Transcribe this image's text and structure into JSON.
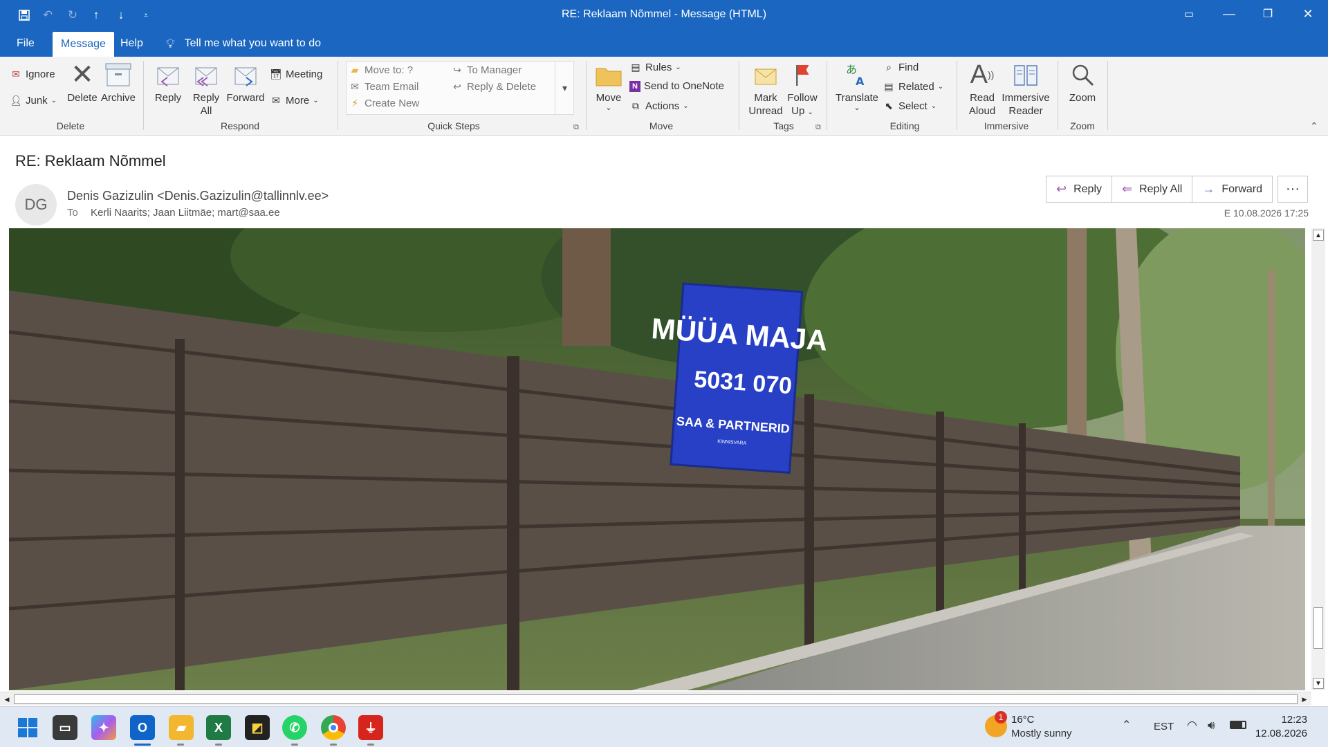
{
  "window": {
    "title": "RE: Reklaam Nõmmel  -  Message (HTML)"
  },
  "menu": {
    "tabs": [
      "File",
      "Message",
      "Help"
    ],
    "tell_me": "Tell me what you want to do"
  },
  "ribbon": {
    "delete_group": {
      "label": "Delete",
      "ignore": "Ignore",
      "junk": "Junk",
      "delete": "Delete",
      "archive": "Archive"
    },
    "respond_group": {
      "label": "Respond",
      "reply": "Reply",
      "reply_all_1": "Reply",
      "reply_all_2": "All",
      "forward": "Forward",
      "meeting": "Meeting",
      "more": "More"
    },
    "quick_steps": {
      "label": "Quick Steps",
      "items": [
        "Move to: ?",
        "Team Email",
        "Create New",
        "To Manager",
        "Reply & Delete"
      ]
    },
    "move_group": {
      "label": "Move",
      "move": "Move",
      "rules": "Rules",
      "onenote": "Send to OneNote",
      "actions": "Actions"
    },
    "tags_group": {
      "label": "Tags",
      "mark_unread_1": "Mark",
      "mark_unread_2": "Unread",
      "follow_up_1": "Follow",
      "follow_up_2": "Up"
    },
    "editing_group": {
      "label": "Editing",
      "translate": "Translate",
      "find": "Find",
      "related": "Related",
      "select": "Select"
    },
    "immersive_group": {
      "label": "Immersive",
      "read_aloud_1": "Read",
      "read_aloud_2": "Aloud",
      "immersive_reader_1": "Immersive",
      "immersive_reader_2": "Reader"
    },
    "zoom_group": {
      "label": "Zoom",
      "zoom": "Zoom"
    }
  },
  "message": {
    "subject": "RE: Reklaam Nõmmel",
    "avatar_initials": "DG",
    "sender": "Denis Gazizulin <Denis.Gazizulin@tallinnlv.ee>",
    "to_label": "To",
    "recipients": "Kerli Naarits; Jaan Liitmäe; mart@saa.ee",
    "datetime": "E 10.08.2026 17:25",
    "actions": {
      "reply": "Reply",
      "reply_all": "Reply All",
      "forward": "Forward",
      "more": "···"
    }
  },
  "photo": {
    "sign_line1": "MÜÜA MAJA",
    "sign_phone": "5031 070",
    "sign_brand": "SAA & PARTNERID",
    "sign_sub": "KINNISVARA"
  },
  "taskbar": {
    "weather_temp": "16°C",
    "weather_desc": "Mostly sunny",
    "weather_badge": "1",
    "language": "EST",
    "time": "12:23",
    "date": "12.08.2026"
  },
  "colors": {
    "accent": "#1a66c0",
    "ribbon_bg": "#f3f3f3",
    "sign_blue": "#2740c6"
  }
}
